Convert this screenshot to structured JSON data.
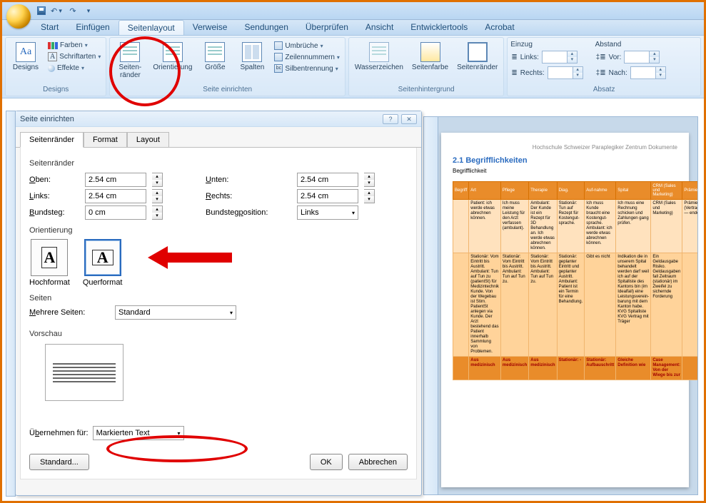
{
  "qat": {
    "save": "Speichern",
    "undo": "Rückgängig",
    "redo": "Wiederholen"
  },
  "tabs": [
    "Start",
    "Einfügen",
    "Seitenlayout",
    "Verweise",
    "Sendungen",
    "Überprüfen",
    "Ansicht",
    "Entwicklertools",
    "Acrobat"
  ],
  "active_tab_index": 2,
  "ribbon": {
    "designs": {
      "title": "Designs",
      "designs": "Designs",
      "farben": "Farben",
      "schriftarten": "Schriftarten",
      "effekte": "Effekte"
    },
    "seite": {
      "title": "Seite einrichten",
      "seitenraender": "Seiten-\nränder",
      "orientierung": "Orientierung",
      "groesse": "Größe",
      "spalten": "Spalten",
      "umbrueche": "Umbrüche",
      "zeilennummern": "Zeilennummern",
      "silbentrennung": "Silbentrennung"
    },
    "hintergrund": {
      "title": "Seitenhintergrund",
      "wasserzeichen": "Wasserzeichen",
      "seitenfarbe": "Seitenfarbe",
      "seitenraender": "Seitenränder"
    },
    "absatz": {
      "title": "Absatz",
      "einzug": "Einzug",
      "links": "Links:",
      "rechts": "Rechts:",
      "abstand": "Abstand",
      "vor": "Vor:",
      "nach": "Nach:"
    }
  },
  "dialog": {
    "title": "Seite einrichten",
    "tabs": [
      "Seitenränder",
      "Format",
      "Layout"
    ],
    "active_tab_index": 0,
    "margins_title": "Seitenränder",
    "oben_lbl": "Oben:",
    "oben_val": "2.54 cm",
    "unten_lbl": "Unten:",
    "unten_val": "2.54 cm",
    "links_lbl": "Links:",
    "links_val": "2.54 cm",
    "rechts_lbl": "Rechts:",
    "rechts_val": "2.54 cm",
    "bundsteg_lbl": "Bundsteg:",
    "bundsteg_val": "0 cm",
    "bundstegpos_lbl": "Bundstegposition:",
    "bundstegpos_val": "Links",
    "orient_title": "Orientierung",
    "hochformat": "Hochformat",
    "querformat": "Querformat",
    "seiten_title": "Seiten",
    "mehrere_lbl": "Mehrere Seiten:",
    "mehrere_val": "Standard",
    "vorschau_title": "Vorschau",
    "uebernehmen_lbl": "Übernehmen für:",
    "uebernehmen_val": "Markierten Text",
    "standard_btn": "Standard...",
    "ok": "OK",
    "cancel": "Abbrechen"
  },
  "doc": {
    "header_small": "Hochschule Schweizer Paraplegiker Zentrum Dokumente",
    "section": "2.1  Begrifflichkeiten",
    "subsection": "Begrifflichkeit",
    "columns": [
      "Begriff",
      "Art",
      "Pflege",
      "Therapie",
      "Diag.",
      "Auf-nahme",
      "Spital",
      "CRM (Sales und Marketing)",
      "Prämien-zahlen"
    ],
    "rows": [
      [
        "",
        "Patient: ich werde etwas abrechnen können.",
        "Ich muss meine Leistung für den Arzt verfassen (ambulant).",
        "Ambulant: Der Kunde ist ein Rezept für 3D Behandlung an. Ich werde etwas abrechnen können.",
        "Stationär: Tun auf Rezept für Kostengut-sprache.",
        "Ich muss Kunde braucht eine Kostengut-sprache. Ambulant: ich werde etwas abrechnen können.",
        "Ich muss eine Rechnung schicken und Zahlungen gang prüfen.",
        "CRM (Sales und Marketing)",
        "Prämien-zahlen (Vertragsbeginn — ende)"
      ],
      [
        "",
        "Stationär: Vom Eintritt bis Austritt. Ambulant: Tun auf Tun zu (patientSt) für Medizintechnik Kunde. Von der Wegebau ist Stirn. PatientSt anlegen via Kunde. Der Arzt bestehend das Patient innerhalb Sammlung von Problemen.",
        "Stationär: Vom Eintritt bis Austritt. Ambulant: Tun auf Tun zu.",
        "Stationär: Vom Eintritt bis Austritt. Ambulant: Tun auf Tun zu.",
        "Stationär: geplanter Eintritt und geplanter Austritt. Ambulant: Patient ist ein Termin für eine Behandlung.",
        "Gibt es nicht",
        "Indikation die in unserem Spital behandelt werden darf weil ich auf der Spitalliste des Kantons bin (im Idealfall) eine Leistungsverein-barung mit dem Kanton habe. KVG Spitalliste KVG Vertrag mit Träger",
        "Ein Geldausgabe Risiko. Geldausgaben fall Zeitraum (stationär) im Zweifel zu sichernde Forderung",
        ""
      ]
    ],
    "footer_row": [
      "",
      "Aus medizinisch",
      "Aus medizinisch",
      "Aus medizinisch",
      "Stationär: -",
      "Stationär: Aufbauschritt",
      "Gleiche Definition wie",
      "Case Management: Von der Wiege bis zur",
      ""
    ]
  }
}
